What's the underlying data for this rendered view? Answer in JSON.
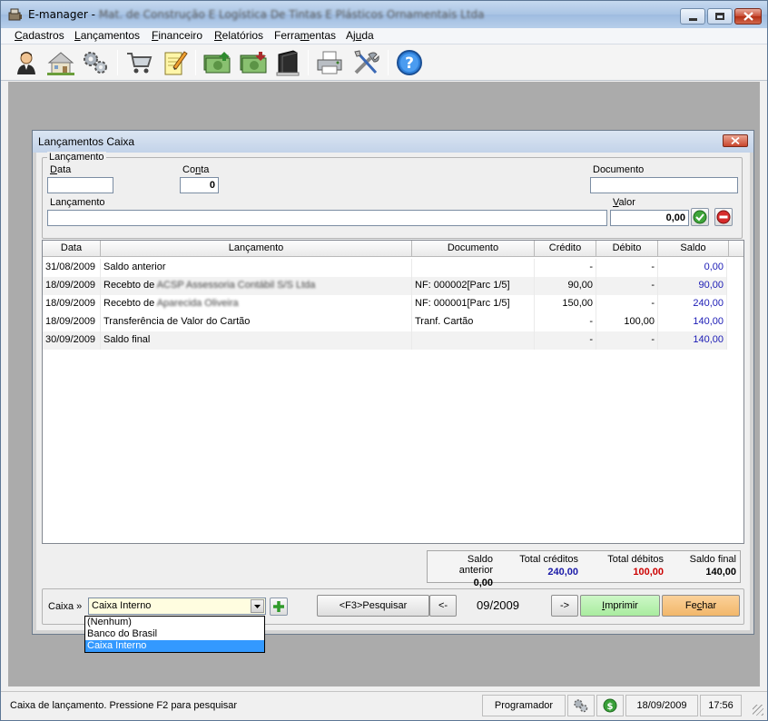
{
  "window": {
    "title_prefix": "E-manager - ",
    "title_obscured": "Mat. de Construção E Logística De Tintas E Plásticos Ornamentais Ltda"
  },
  "menu": [
    {
      "label": "Cadastros",
      "accel": "C"
    },
    {
      "label": "Lançamentos",
      "accel": "L"
    },
    {
      "label": "Financeiro",
      "accel": "F"
    },
    {
      "label": "Relatórios",
      "accel": "R"
    },
    {
      "label": "Ferramentas",
      "accel": "m"
    },
    {
      "label": "Ajuda",
      "accel": "u"
    }
  ],
  "toolbar": {
    "icons": [
      "user-icon",
      "house-icon",
      "gears-icon",
      "cart-icon",
      "notepad-pencil-icon",
      "money-in-icon",
      "money-out-icon",
      "book-icon",
      "printer-icon",
      "tools-icon",
      "help-icon"
    ]
  },
  "child": {
    "title": "Lançamentos Caixa",
    "group_legend": "Lançamento",
    "labels": {
      "data": "Data",
      "conta": "Conta",
      "documento": "Documento",
      "lancamento": "Lançamento",
      "valor": "Valor"
    },
    "fields": {
      "data": "",
      "conta": "0",
      "documento": "",
      "lancamento": "",
      "valor": "0,00"
    }
  },
  "table": {
    "columns": [
      "Data",
      "Lançamento",
      "Documento",
      "Crédito",
      "Débito",
      "Saldo"
    ],
    "rows": [
      {
        "data": "31/08/2009",
        "lancamento": "Saldo anterior",
        "obscured": "",
        "documento": "",
        "credito": "-",
        "debito": "-",
        "saldo": "0,00"
      },
      {
        "data": "18/09/2009",
        "lancamento": "Recebto de ",
        "obscured": "ACSP Assessoria Contábil S/S Ltda",
        "documento": "NF: 000002[Parc 1/5]",
        "credito": "90,00",
        "debito": "-",
        "saldo": "90,00"
      },
      {
        "data": "18/09/2009",
        "lancamento": "Recebto de ",
        "obscured": "Aparecida Oliveira",
        "documento": "NF: 000001[Parc 1/5]",
        "credito": "150,00",
        "debito": "-",
        "saldo": "240,00"
      },
      {
        "data": "18/09/2009",
        "lancamento": "Transferência de Valor do Cartão",
        "obscured": "",
        "documento": "Tranf. Cartão",
        "credito": "-",
        "debito": "100,00",
        "saldo": "140,00"
      },
      {
        "data": "30/09/2009",
        "lancamento": "Saldo final",
        "obscured": "",
        "documento": "",
        "credito": "-",
        "debito": "-",
        "saldo": "140,00"
      }
    ]
  },
  "totals": {
    "saldo_anterior_label": "Saldo anterior",
    "saldo_anterior": "0,00",
    "total_creditos_label": "Total créditos",
    "total_creditos": "240,00",
    "total_debitos_label": "Total débitos",
    "total_debitos": "100,00",
    "saldo_final_label": "Saldo final",
    "saldo_final": "140,00"
  },
  "bottom": {
    "caixa_label": "Caixa »",
    "caixa_value": "Caixa Interno",
    "options": [
      "(Nenhum)",
      "Banco do Brasil",
      "Caixa Interno"
    ],
    "selected_index": 2,
    "pesquisar": "<F3>Pesquisar",
    "prev": "<-",
    "period": "09/2009",
    "next": "->",
    "imprimir": "Imprimir",
    "fechar": "Fechar"
  },
  "colors": {
    "credit_blue": "#1a1aa8",
    "debit_red": "#cc0000",
    "imprimir_bg": "#b9f2b2",
    "fechar_bg": "#f7c27c",
    "saldo_blue": "#1b1bb5"
  },
  "status": {
    "message": "Caixa de lançamento. Pressione F2 para pesquisar",
    "user": "Programador",
    "date": "18/09/2009",
    "time": "17:56"
  }
}
